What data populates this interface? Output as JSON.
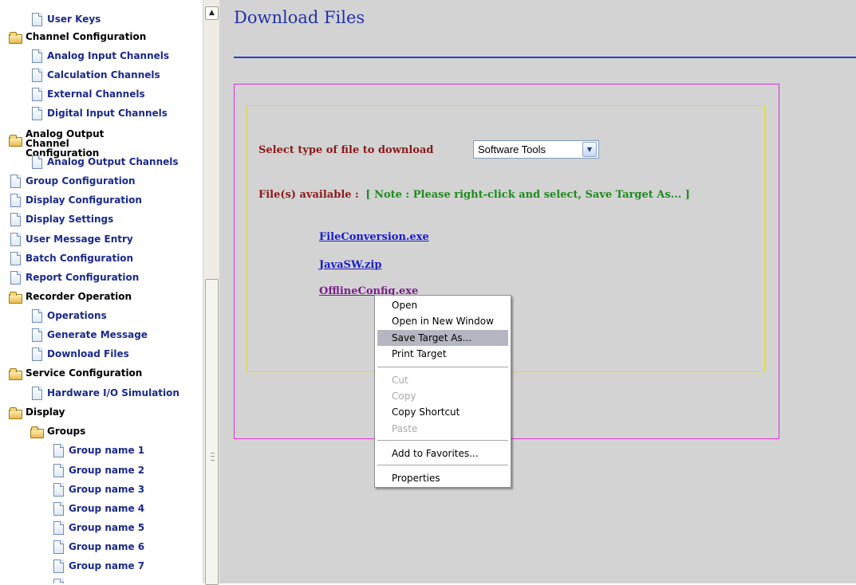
{
  "tree": {
    "items": [
      {
        "label": "User Keys",
        "type": "leaf"
      },
      {
        "label": "Channel Configuration",
        "type": "folder"
      },
      {
        "label": "Analog Input Channels",
        "type": "leaf"
      },
      {
        "label": "Calculation Channels",
        "type": "leaf"
      },
      {
        "label": "External Channels",
        "type": "leaf"
      },
      {
        "label": "Digital Input Channels",
        "type": "leaf"
      },
      {
        "label": "Analog Output Channel Configuration",
        "type": "folder"
      },
      {
        "label": "Analog Output Channels",
        "type": "leaf"
      },
      {
        "label": "Group Configuration",
        "type": "leaf"
      },
      {
        "label": "Display Configuration",
        "type": "leaf"
      },
      {
        "label": "Display Settings",
        "type": "leaf"
      },
      {
        "label": "User Message Entry",
        "type": "leaf"
      },
      {
        "label": "Batch Configuration",
        "type": "leaf"
      },
      {
        "label": "Report Configuration",
        "type": "leaf"
      },
      {
        "label": "Recorder Operation",
        "type": "folder"
      },
      {
        "label": "Operations",
        "type": "leaf"
      },
      {
        "label": "Generate Message",
        "type": "leaf"
      },
      {
        "label": "Download Files",
        "type": "leaf"
      },
      {
        "label": "Service Configuration",
        "type": "folder"
      },
      {
        "label": "Hardware I/O Simulation",
        "type": "leaf"
      },
      {
        "label": "Display",
        "type": "folder"
      },
      {
        "label": "Groups",
        "type": "folder"
      },
      {
        "label": "Group name 1",
        "type": "leaf"
      },
      {
        "label": "Group name 2",
        "type": "leaf"
      },
      {
        "label": "Group name 3",
        "type": "leaf"
      },
      {
        "label": "Group name 4",
        "type": "leaf"
      },
      {
        "label": "Group name 5",
        "type": "leaf"
      },
      {
        "label": "Group name 6",
        "type": "leaf"
      },
      {
        "label": "Group name 7",
        "type": "leaf"
      }
    ]
  },
  "main": {
    "title": "Download Files",
    "select_label": "Select type of file to download",
    "file_type": {
      "selected": "Software Tools"
    },
    "available_label": "File(s) available :",
    "available_note": "[ Note : Please right-click and select, Save Target As... ]",
    "files": [
      "FileConversion.exe",
      "JavaSW.zip",
      "OfflineConfig.exe"
    ]
  },
  "context_menu": {
    "items": [
      {
        "label": "Open",
        "disabled": false
      },
      {
        "label": "Open in New Window",
        "disabled": false
      },
      {
        "label": "Save Target As...",
        "disabled": false,
        "highlighted": true
      },
      {
        "label": "Print Target",
        "disabled": false
      },
      {
        "label": "Cut",
        "disabled": true
      },
      {
        "label": "Copy",
        "disabled": true
      },
      {
        "label": "Copy Shortcut",
        "disabled": false
      },
      {
        "label": "Paste",
        "disabled": true
      },
      {
        "label": "Add to Favorites...",
        "disabled": false
      },
      {
        "label": "Properties",
        "disabled": false
      }
    ]
  },
  "colors": {
    "content_bg": "#d3d3d3",
    "title": "#2431a6",
    "outer_border": "#e12fd8",
    "inner_border": "#e6dc23",
    "label_red": "#8b1a1a",
    "note_green": "#1e8a1e",
    "link_blue": "#1a1acc",
    "link_visited": "#7a1f8a",
    "menu_highlight": "#b6b6c2"
  }
}
